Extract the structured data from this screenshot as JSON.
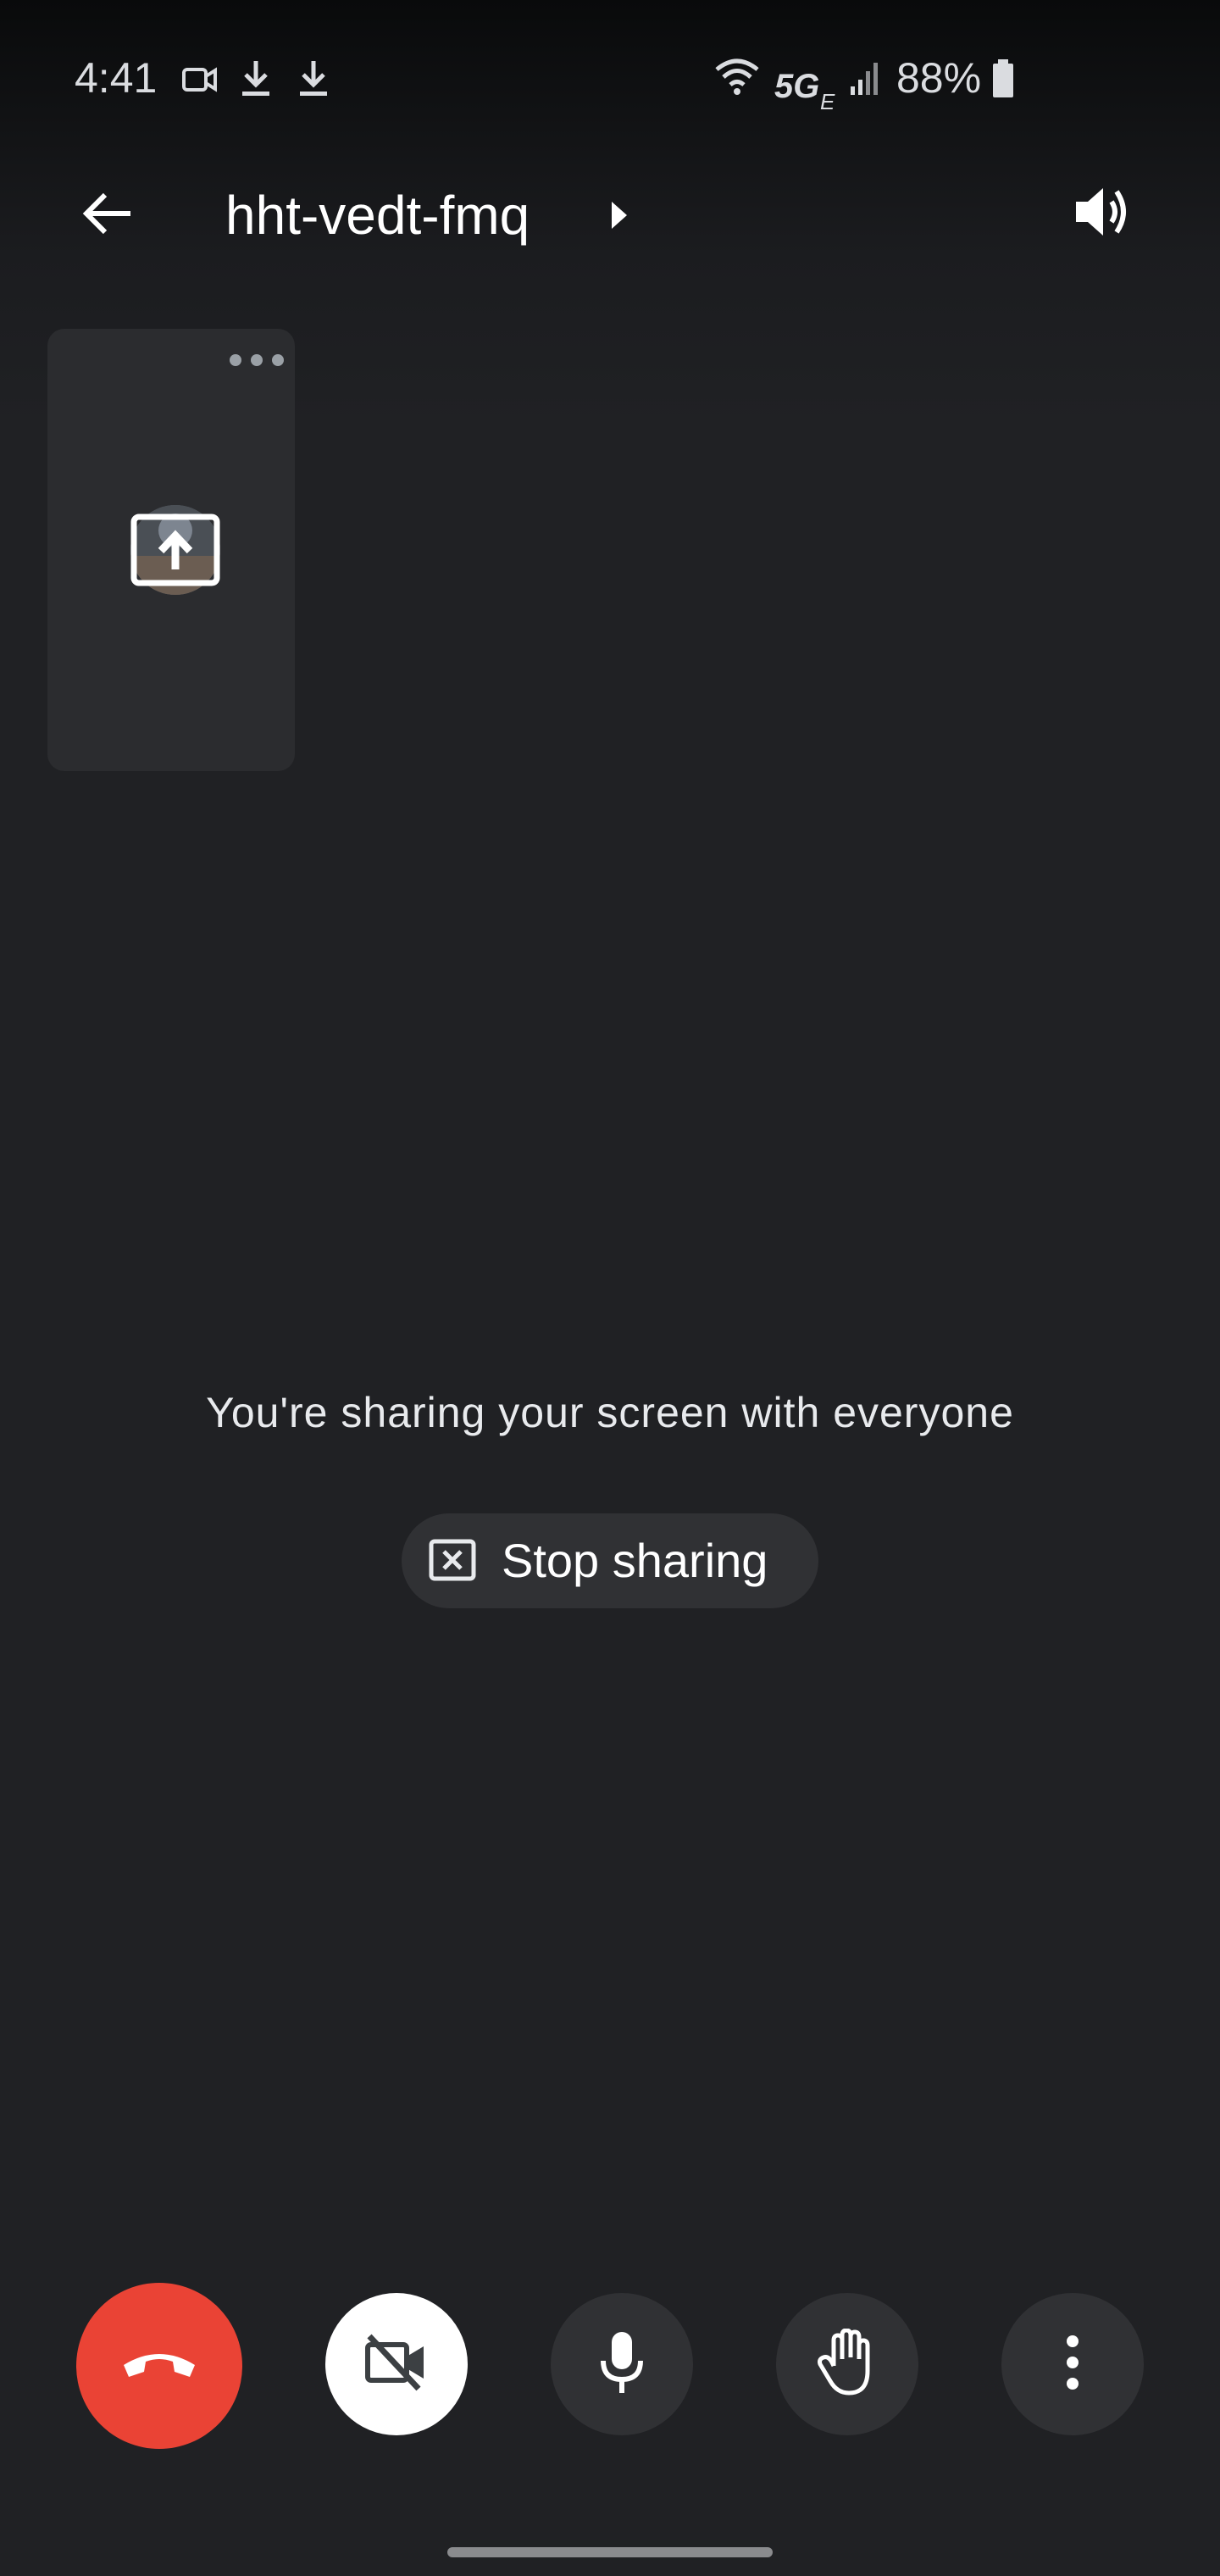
{
  "status_bar": {
    "time": "4:41",
    "network": "5G",
    "network_sub": "E",
    "battery": "88%"
  },
  "app_bar": {
    "meeting_code": "hht-vedt-fmq"
  },
  "main": {
    "share_message": "You're sharing your screen with everyone",
    "stop_sharing_label": "Stop sharing"
  },
  "colors": {
    "background": "#202124",
    "end_call": "#ea4335",
    "control_bg": "#303134",
    "camera_off_bg": "#ffffff"
  },
  "icons": {
    "status": [
      "video-camera-icon",
      "download-icon",
      "download-icon",
      "wifi-icon",
      "signal-icon",
      "battery-icon"
    ],
    "app_bar": [
      "back-arrow-icon",
      "chevron-right-icon",
      "speaker-icon"
    ],
    "controls": [
      "end-call-icon",
      "camera-off-icon",
      "microphone-icon",
      "raise-hand-icon",
      "more-vertical-icon"
    ]
  }
}
